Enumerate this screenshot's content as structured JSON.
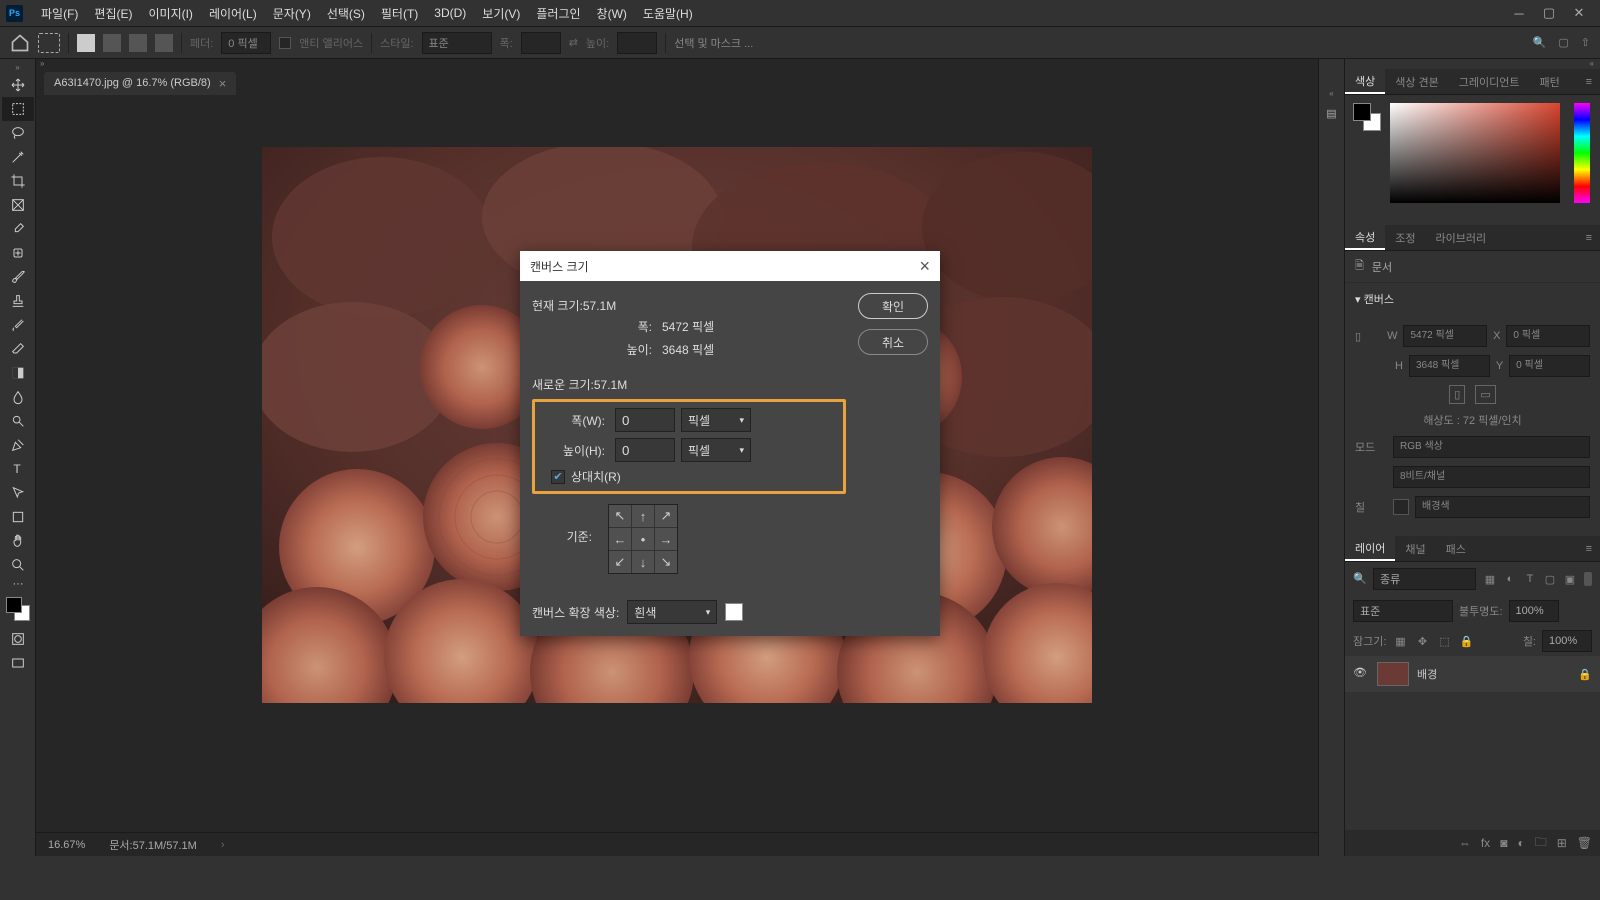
{
  "menu": {
    "items": [
      "파일(F)",
      "편집(E)",
      "이미지(I)",
      "레이어(L)",
      "문자(Y)",
      "선택(S)",
      "필터(T)",
      "3D(D)",
      "보기(V)",
      "플러그인",
      "창(W)",
      "도움말(H)"
    ]
  },
  "optbar": {
    "feather_label": "페더:",
    "feather_value": "0 픽셀",
    "antialias": "앤티 앨리어스",
    "style_label": "스타일:",
    "style_value": "표준",
    "width_label": "폭:",
    "height_label": "높이:",
    "selmask": "선택 및 마스크 ..."
  },
  "doc": {
    "tab_title": "A63I1470.jpg @ 16.7% (RGB/8)"
  },
  "status": {
    "zoom": "16.67%",
    "doc": "문서:57.1M/57.1M"
  },
  "color_tabs": [
    "색상",
    "색상 견본",
    "그레이디언트",
    "패턴"
  ],
  "prop_tabs": [
    "속성",
    "조정",
    "라이브러리"
  ],
  "prop": {
    "doc": "문서",
    "canvas": "캔버스",
    "w": "W",
    "w_val": "5472 픽셀",
    "x": "X",
    "x_val": "0 픽셀",
    "h": "H",
    "h_val": "3648 픽셀",
    "y": "Y",
    "y_val": "0 픽셀",
    "res": "해상도 : 72 픽셀/인치",
    "mode": "모드",
    "mode_val": "RGB 색상",
    "bits": "8비트/채널",
    "fill": "칠",
    "fill_val": "배경색"
  },
  "layer_tabs": [
    "레이어",
    "채널",
    "패스"
  ],
  "layer": {
    "type": "종류",
    "blend": "표준",
    "opacity_label": "불투명도:",
    "opacity": "100%",
    "lock_label": "잠그기:",
    "fill_label": "칠:",
    "fill": "100%",
    "bg_name": "배경"
  },
  "dialog": {
    "title": "캔버스 크기",
    "current_size_label": "현재 크기:",
    "current_size": "57.1M",
    "cur_w_label": "폭:",
    "cur_w": "5472 픽셀",
    "cur_h_label": "높이:",
    "cur_h": "3648 픽셀",
    "new_size_label": "새로운 크기:",
    "new_size": "57.1M",
    "new_w_label": "폭(W):",
    "new_w": "0",
    "new_w_unit": "픽셀",
    "new_h_label": "높이(H):",
    "new_h": "0",
    "new_h_unit": "픽셀",
    "relative": "상대치(R)",
    "anchor_label": "기준:",
    "ext_label": "캔버스 확장 색상:",
    "ext_value": "흰색",
    "ok": "확인",
    "cancel": "취소"
  }
}
